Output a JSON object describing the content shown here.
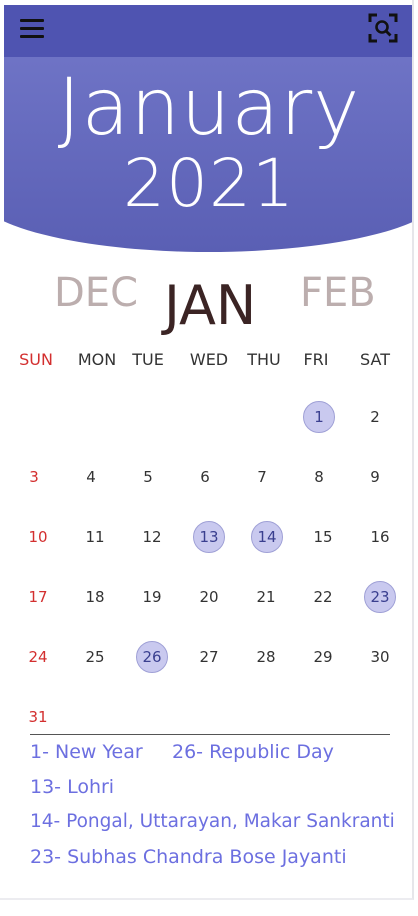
{
  "header": {
    "month": "January",
    "year": "2021"
  },
  "switcher": {
    "prev": "DEC",
    "current": "JAN",
    "next": "FEB"
  },
  "weekdays": [
    "SUN",
    "MON",
    "TUE",
    "WED",
    "THU",
    "FRI",
    "SAT"
  ],
  "days": [
    "1",
    "2",
    "3",
    "4",
    "5",
    "6",
    "7",
    "8",
    "9",
    "10",
    "11",
    "12",
    "13",
    "14",
    "15",
    "16",
    "17",
    "18",
    "19",
    "20",
    "21",
    "22",
    "23",
    "24",
    "25",
    "26",
    "27",
    "28",
    "29",
    "30",
    "31"
  ],
  "highlighted_days": [
    "1",
    "13",
    "14",
    "23",
    "26"
  ],
  "holidays": {
    "line1a": "1- New Year",
    "line1b": "26- Republic Day",
    "line2": "13- Lohri",
    "line3": "14- Pongal, Uttarayan, Makar Sankranti",
    "line4": "23- Subhas Chandra Bose Jayanti"
  },
  "colors": {
    "header_top": "#4f54b1",
    "header_gradient": "#6f74c6",
    "sunday": "#d32f2f",
    "holiday_text": "#6c6fe0",
    "holiday_circle": "#c9c9ef"
  },
  "icons": {
    "menu": "hamburger-menu-icon",
    "scan": "scan-search-icon"
  }
}
